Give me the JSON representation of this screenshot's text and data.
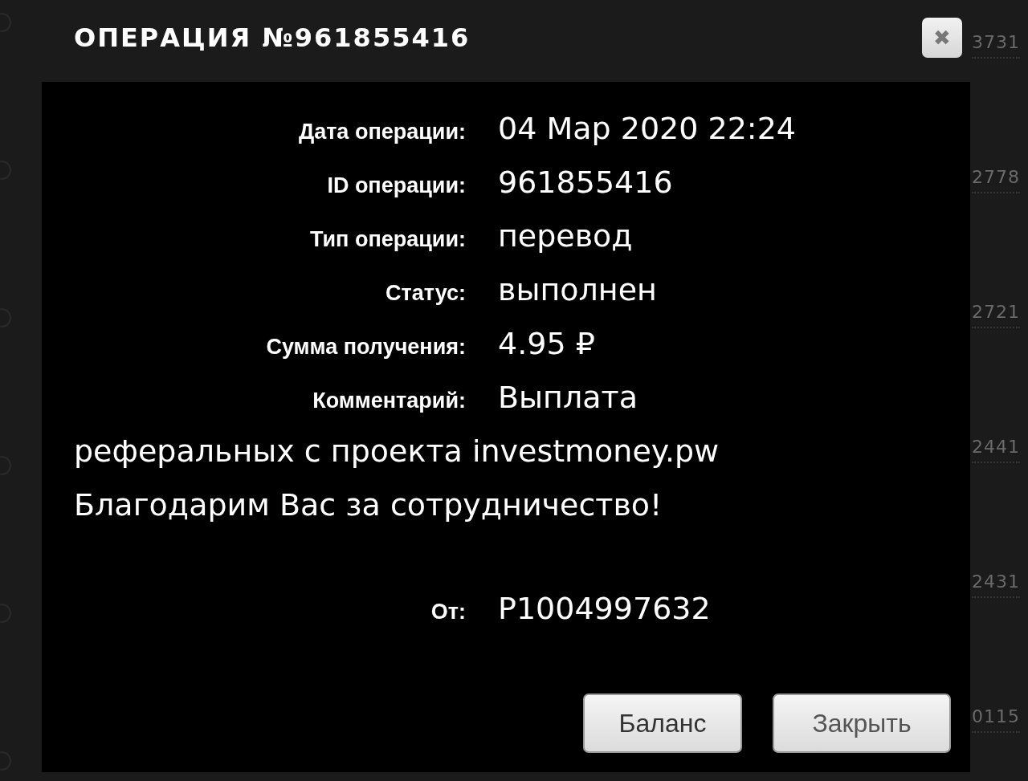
{
  "dialog": {
    "title": "ОПЕРАЦИЯ №961855416",
    "close_label": "✖",
    "fields": [
      {
        "label": "Дата операции:",
        "value": "04 Мар 2020 22:24"
      },
      {
        "label": "ID операции:",
        "value": "961855416"
      },
      {
        "label": "Тип операции:",
        "value": "перевод"
      },
      {
        "label": "Статус:",
        "value": "выполнен"
      },
      {
        "label": "Сумма получения:",
        "value": "4.95 ₽"
      }
    ],
    "comment": {
      "label": "Комментарий:",
      "lines": [
        "Выплата",
        "реферальных с проекта investmoney.pw",
        "Благодарим Вас за сотрудничество!"
      ]
    },
    "sender": {
      "label": "От:",
      "value": "P1004997632"
    },
    "buttons": [
      "Баланс",
      "Закрыть"
    ]
  },
  "background_numbers": [
    "3731",
    "2778",
    "2721",
    "2441",
    "2431",
    "0115"
  ]
}
